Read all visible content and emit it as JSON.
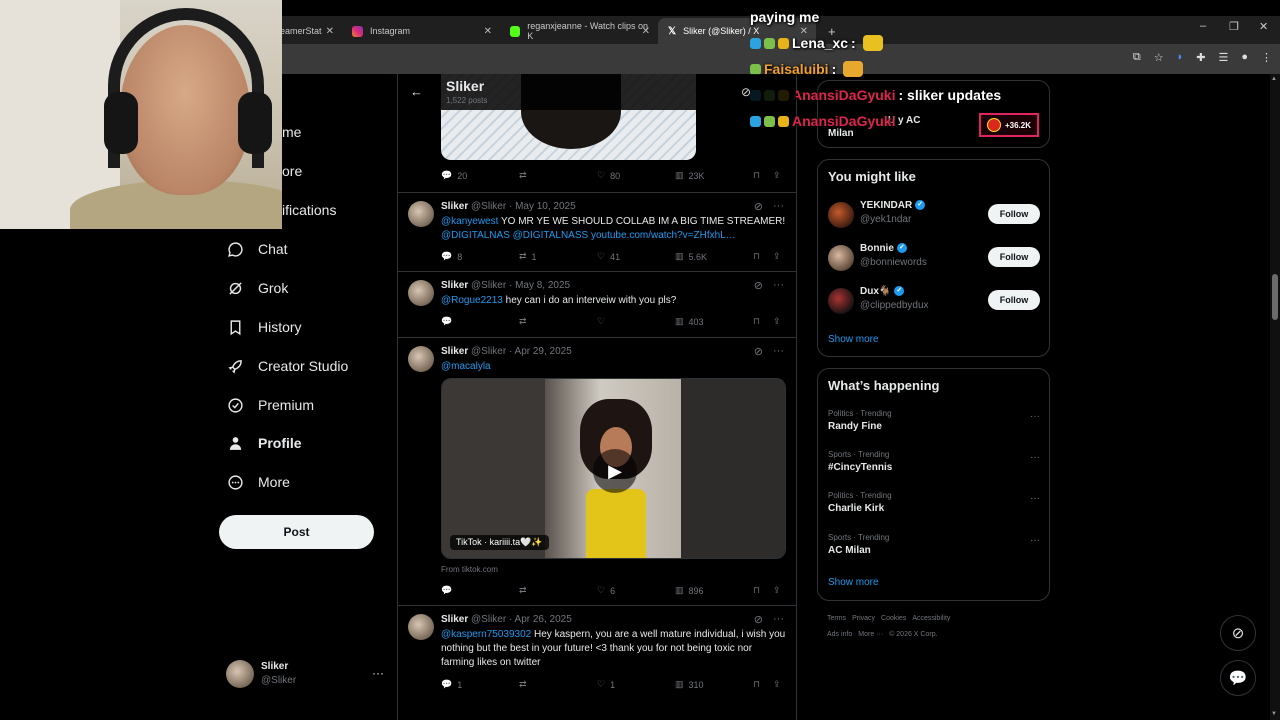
{
  "browser": {
    "tabs": [
      {
        "label": "eamerStat",
        "active": false
      },
      {
        "label": "Instagram",
        "active": false
      },
      {
        "label": "reganxjeanne - Watch clips on K",
        "active": false
      },
      {
        "label": "Sliker (@Sliker) / X",
        "active": true
      }
    ],
    "new_tab": "+",
    "window_controls": {
      "minimize": "–",
      "restore": "❐",
      "close": "✕"
    }
  },
  "sidebar": {
    "partial_items": [
      "me",
      "ore",
      "ifications"
    ],
    "items": [
      {
        "label": "Chat",
        "icon": "chat-icon"
      },
      {
        "label": "Grok",
        "icon": "grok-icon"
      },
      {
        "label": "History",
        "icon": "bookmark-icon"
      },
      {
        "label": "Creator Studio",
        "icon": "rocket-icon"
      },
      {
        "label": "Premium",
        "icon": "verified-icon"
      },
      {
        "label": "Profile",
        "icon": "person-icon",
        "active": true
      },
      {
        "label": "More",
        "icon": "more-icon"
      }
    ],
    "post_label": "Post",
    "account": {
      "name": "Sliker",
      "handle": "@Sliker",
      "menu": "···"
    }
  },
  "profile_header": {
    "name": "Sliker",
    "posts": "1,522 posts"
  },
  "first_post_actions": {
    "replies": "20",
    "reposts": "",
    "likes": "80",
    "views": "23K"
  },
  "tweets": [
    {
      "name": "Sliker",
      "handle": "@Sliker",
      "date": "May 10, 2025",
      "mention": "@kanyewest",
      "text": " YO MR YE WE SHOULD COLLAB IM A BIG TIME STREAMER!",
      "line2": "@DIGITALNAS  @DIGITALNASS youtube.com/watch?v=ZHfxhL…",
      "replies": "8",
      "reposts": "1",
      "likes": "41",
      "views": "5.6K"
    },
    {
      "name": "Sliker",
      "handle": "@Sliker",
      "date": "May 8, 2025",
      "mention": "@Rogue2213",
      "text": " hey can i do an interveiw with you pls?",
      "replies": "",
      "reposts": "",
      "likes": "",
      "views": "403"
    },
    {
      "name": "Sliker",
      "handle": "@Sliker",
      "date": "Apr 29, 2025",
      "mention": "@macalyla",
      "video_label": "TikTok · kariiii.ta🤍✨",
      "from": "From tiktok.com",
      "replies": "",
      "reposts": "",
      "likes": "6",
      "views": "896"
    },
    {
      "name": "Sliker",
      "handle": "@Sliker",
      "date": "Apr 26, 2025",
      "mention": "@kaspern75039302",
      "text": " Hey kaspern, you are a well mature individual, i wish you nothing but the best in your future! <3 thank you for not being toxic nor farming likes on twitter",
      "replies": "1",
      "reposts": "",
      "likes": "1",
      "views": "310"
    }
  ],
  "right_column": {
    "hidden_trend": {
      "line1": "U y AC",
      "line2": "Milan",
      "badge": "+36.2K"
    },
    "you_might_like": {
      "title": "You might like",
      "people": [
        {
          "name": "YEKINDAR",
          "handle": "@yek1ndar",
          "follow": "Follow"
        },
        {
          "name": "Bonnie",
          "handle": "@bonniewords",
          "follow": "Follow"
        },
        {
          "name": "Dux🐐",
          "handle": "@clippedbydux",
          "follow": "Follow"
        }
      ],
      "show_more": "Show more"
    },
    "whats_happening": {
      "title": "What’s happening",
      "trends": [
        {
          "category": "Politics · Trending",
          "topic": "Randy Fine"
        },
        {
          "category": "Sports · Trending",
          "topic": "#CincyTennis"
        },
        {
          "category": "Politics · Trending",
          "topic": "Charlie Kirk"
        },
        {
          "category": "Sports · Trending",
          "topic": "AC Milan"
        }
      ],
      "show_more": "Show more"
    },
    "footer": [
      "Terms",
      "Privacy",
      "Cookies",
      "Accessibility",
      "Ads info",
      "More ···",
      "© 2026 X Corp."
    ]
  },
  "chat_overlay": {
    "lines": [
      {
        "user": "",
        "message": "paying me",
        "color": "#ffffff"
      },
      {
        "user": "Lena_xc",
        "message": " :",
        "color": "#ffffff"
      },
      {
        "user": "Faisaluibi",
        "message": " :",
        "color": "#f0a030"
      },
      {
        "user": "AnansiDaGyuki",
        "message": " : sliker updates",
        "color": "#e0244e"
      },
      {
        "user": "AnansiDaGyuki",
        "message": "",
        "color": "#e0244e"
      }
    ]
  },
  "colors": {
    "accent": "#1d9bf0",
    "background": "#000000",
    "border": "#2f3336",
    "muted": "#71767b"
  }
}
